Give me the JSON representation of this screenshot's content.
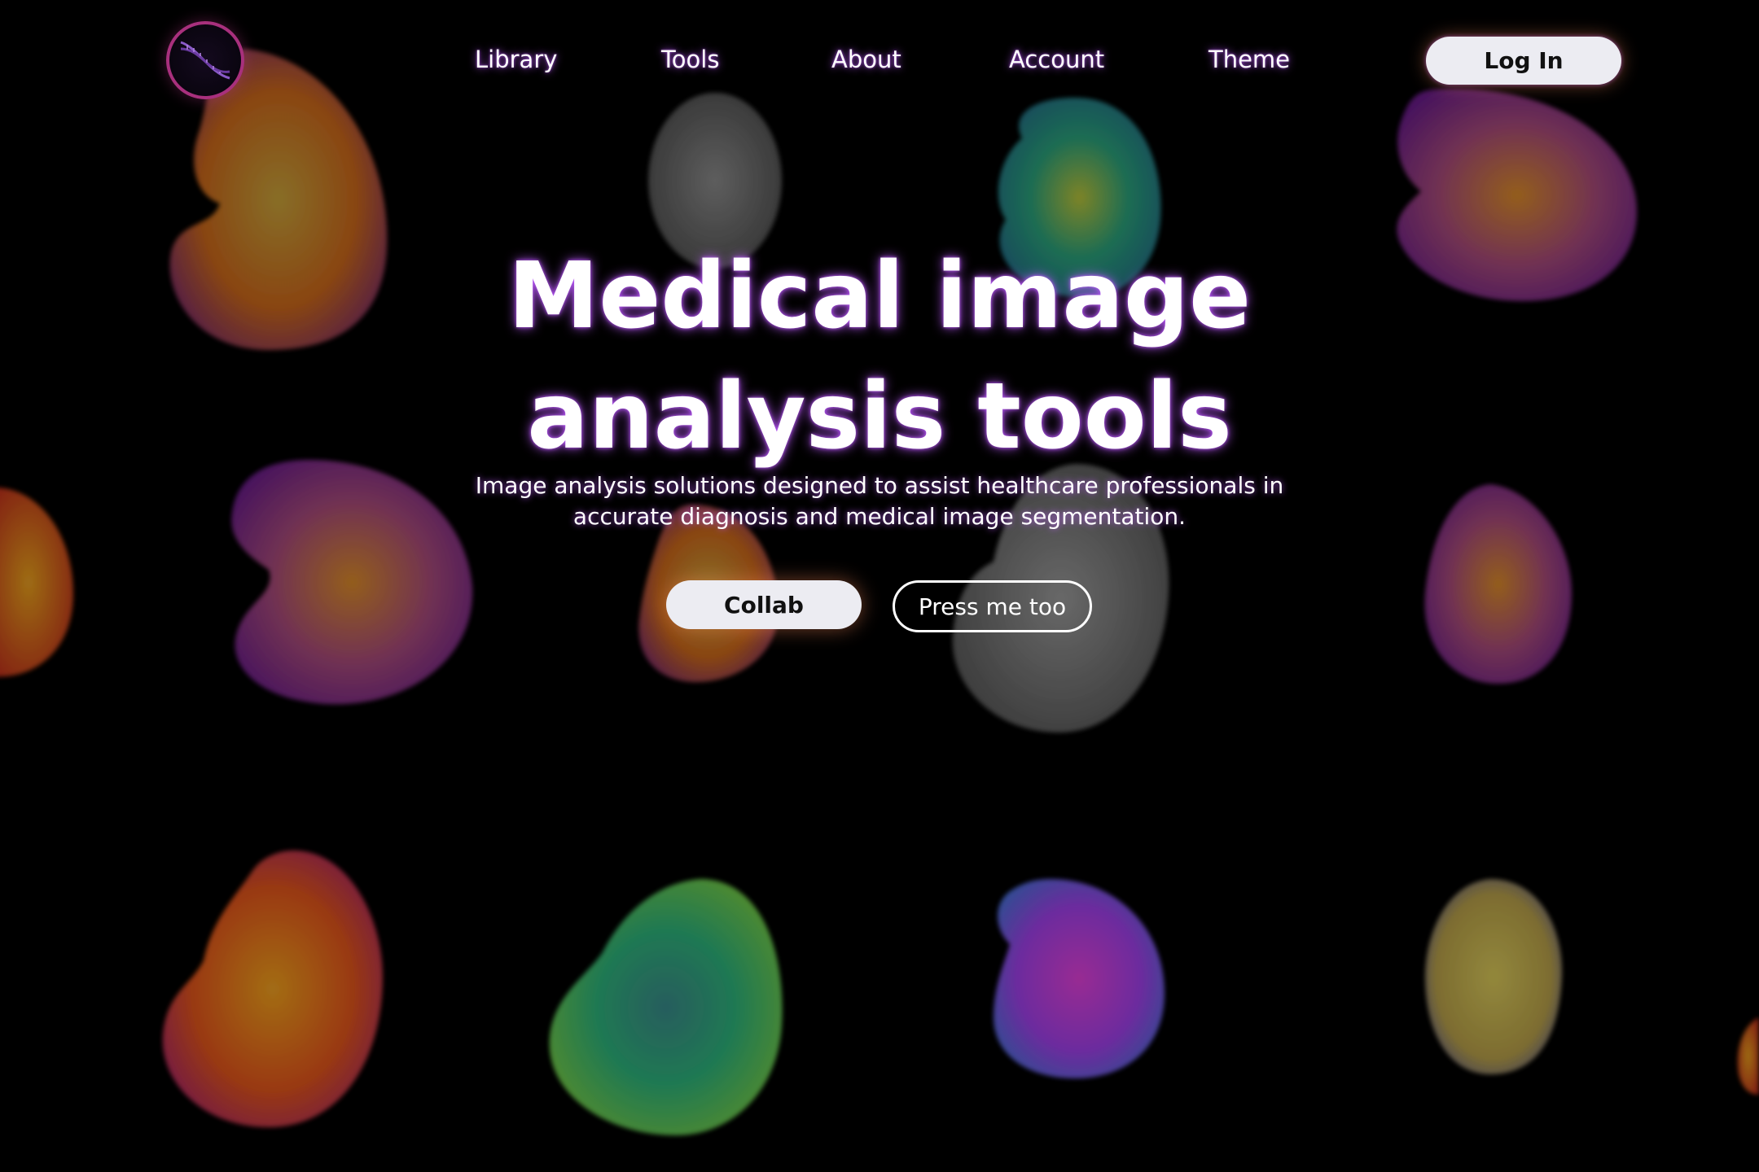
{
  "header": {
    "logo_icon": "dna-helix-icon",
    "nav": [
      {
        "label": "Library"
      },
      {
        "label": "Tools"
      },
      {
        "label": "About"
      },
      {
        "label": "Account"
      },
      {
        "label": "Theme"
      }
    ],
    "login_label": "Log In"
  },
  "hero": {
    "title_line1": "Medical image",
    "title_line2": "analysis tools",
    "subtitle_line1": "Image analysis solutions designed to assist healthcare professionals in",
    "subtitle_line2": "accurate diagnosis and medical image segmentation.",
    "primary_button": "Collab",
    "secondary_button": "Press me too"
  },
  "background": {
    "description_icon": "brain-mri-slices",
    "colors": [
      "#d4891e",
      "#7a7a7a",
      "#1f9a7a",
      "#a23aa8",
      "#e85a14",
      "#3fbf8a",
      "#c23ae0",
      "#c9b84a"
    ]
  }
}
